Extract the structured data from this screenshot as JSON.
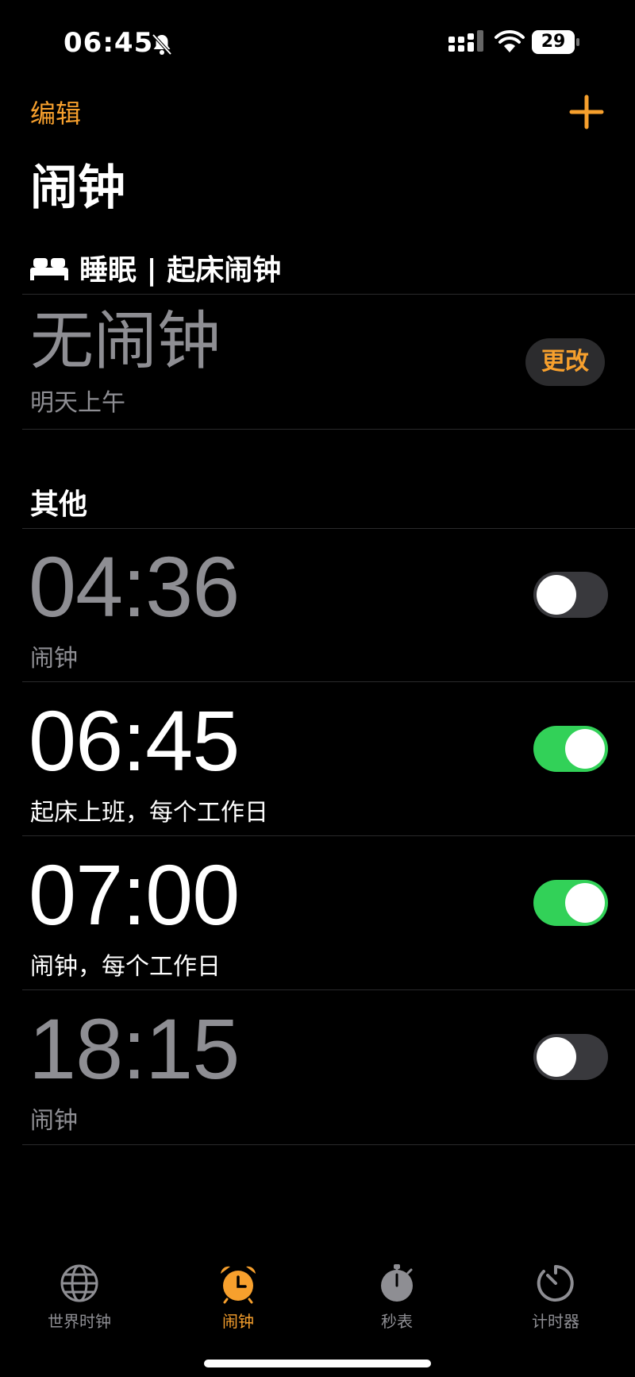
{
  "status_bar": {
    "time": "06:45",
    "battery": "29",
    "icons": [
      "bell-slash-icon",
      "signal-icon",
      "wifi-icon",
      "battery-icon"
    ]
  },
  "nav": {
    "edit_label": "编辑",
    "add_icon": "plus-icon"
  },
  "title": "闹钟",
  "sleep_section": {
    "header": "睡眠 | 起床闹钟",
    "icon": "bed-icon",
    "no_alarm": "无闹钟",
    "subtitle": "明天上午",
    "change_label": "更改"
  },
  "other_section": {
    "header": "其他"
  },
  "alarms": [
    {
      "time": "04:36",
      "label": "闹钟",
      "enabled": false
    },
    {
      "time": "06:45",
      "label": "起床上班，每个工作日",
      "enabled": true
    },
    {
      "time": "07:00",
      "label": "闹钟，每个工作日",
      "enabled": true
    },
    {
      "time": "18:15",
      "label": "闹钟",
      "enabled": false
    }
  ],
  "tabs": [
    {
      "label": "世界时钟",
      "icon": "globe-icon",
      "active": false
    },
    {
      "label": "闹钟",
      "icon": "alarm-clock-icon",
      "active": true
    },
    {
      "label": "秒表",
      "icon": "stopwatch-icon",
      "active": false
    },
    {
      "label": "计时器",
      "icon": "timer-icon",
      "active": false
    }
  ],
  "colors": {
    "accent": "#f7a02d",
    "toggle_on": "#32d158",
    "toggle_off": "#39393d",
    "secondary_text": "#8e8e93",
    "background": "#000000"
  }
}
